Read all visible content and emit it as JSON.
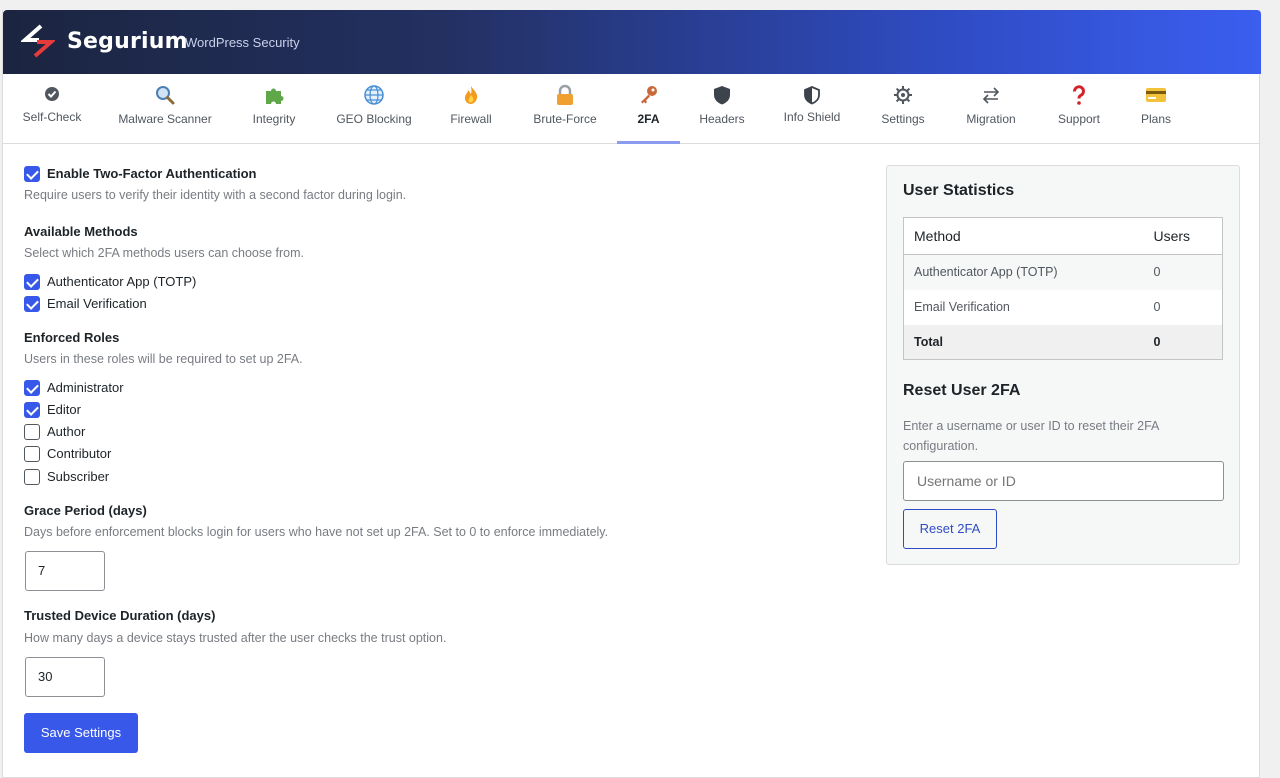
{
  "header": {
    "brand": "Segurium",
    "subtitle": "WordPress Security"
  },
  "tabs": [
    {
      "label": "Self-Check",
      "icon": "check-circle-icon"
    },
    {
      "label": "Malware Scanner",
      "icon": "magnifier-icon"
    },
    {
      "label": "Integrity",
      "icon": "puzzle-icon"
    },
    {
      "label": "GEO Blocking",
      "icon": "globe-icon"
    },
    {
      "label": "Firewall",
      "icon": "fire-icon"
    },
    {
      "label": "Brute-Force",
      "icon": "padlock-icon"
    },
    {
      "label": "2FA",
      "icon": "key-icon",
      "active": true
    },
    {
      "label": "Headers",
      "icon": "shield-icon"
    },
    {
      "label": "Info Shield",
      "icon": "shield-half-icon"
    },
    {
      "label": "Settings",
      "icon": "gear-icon"
    },
    {
      "label": "Migration",
      "icon": "arrows-icon"
    },
    {
      "label": "Support",
      "icon": "question-icon"
    },
    {
      "label": "Plans",
      "icon": "credit-card-icon"
    }
  ],
  "main": {
    "enable": {
      "label": "Enable Two-Factor Authentication",
      "desc": "Require users to verify their identity with a second factor during login.",
      "checked": true
    },
    "methods": {
      "title": "Available Methods",
      "desc": "Select which 2FA methods users can choose from.",
      "items": [
        {
          "label": "Authenticator App (TOTP)",
          "checked": true
        },
        {
          "label": "Email Verification",
          "checked": true
        }
      ]
    },
    "roles": {
      "title": "Enforced Roles",
      "desc": "Users in these roles will be required to set up 2FA.",
      "items": [
        {
          "label": "Administrator",
          "checked": true
        },
        {
          "label": "Editor",
          "checked": true
        },
        {
          "label": "Author",
          "checked": false
        },
        {
          "label": "Contributor",
          "checked": false
        },
        {
          "label": "Subscriber",
          "checked": false
        }
      ]
    },
    "grace": {
      "title": "Grace Period (days)",
      "desc": "Days before enforcement blocks login for users who have not set up 2FA. Set to 0 to enforce immediately.",
      "value": "7"
    },
    "trusted": {
      "title": "Trusted Device Duration (days)",
      "desc": "How many days a device stays trusted after the user checks the trust option.",
      "value": "30"
    },
    "save_label": "Save Settings"
  },
  "side": {
    "stats_title": "User Statistics",
    "table": {
      "headers": [
        "Method",
        "Users"
      ],
      "rows": [
        [
          "Authenticator App (TOTP)",
          "0"
        ],
        [
          "Email Verification",
          "0"
        ]
      ],
      "total": [
        "Total",
        "0"
      ]
    },
    "reset_title": "Reset User 2FA",
    "reset_desc_1": "Enter a username or user ID to reset their 2FA",
    "reset_desc_2": "configuration.",
    "reset_placeholder": "Username or ID",
    "reset_button": "Reset 2FA"
  },
  "colors": {
    "accent": "#3858e9",
    "header_start": "#1b2540",
    "header_end": "#3b5ef0"
  }
}
